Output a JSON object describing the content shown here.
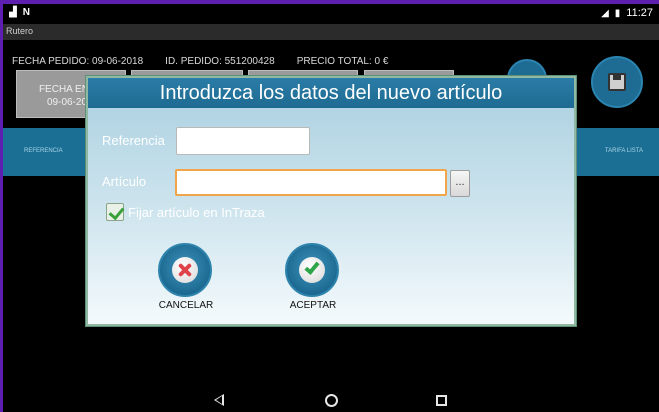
{
  "status_bar": {
    "left_icons": [
      "signal-icon",
      "notification-n-icon"
    ],
    "time": "11:27"
  },
  "app_bar": {
    "title": "Rutero"
  },
  "info": {
    "fecha_pedido": "FECHA PEDIDO: 09-06-2018",
    "id_pedido": "ID. PEDIDO: 551200428",
    "precio_total": "PRECIO TOTAL: 0 €"
  },
  "background_buttons": {
    "fecha_entrega": "FECHA ENT",
    "fecha_entrega_value": "09-06-20"
  },
  "list_header": {
    "left": "REFERENCIA",
    "right": "TARIFA LISTA"
  },
  "dialog": {
    "title": "Introduzca los datos del nuevo artículo",
    "referencia_label": "Referencia",
    "referencia_value": "",
    "articulo_label": "Artículo",
    "articulo_value": "",
    "browse_button": "...",
    "fijar_checkbox_label": "Fijar artículo en InTraza",
    "fijar_checked": true,
    "cancel_label": "CANCELAR",
    "accept_label": "ACEPTAR"
  },
  "colors": {
    "dialog_title_bg": "#1e6b92",
    "round_button": "#1c6a92",
    "focus_border": "#f0a54a",
    "cancel_x": "#e0424a",
    "accept_check": "#2fa54a"
  }
}
